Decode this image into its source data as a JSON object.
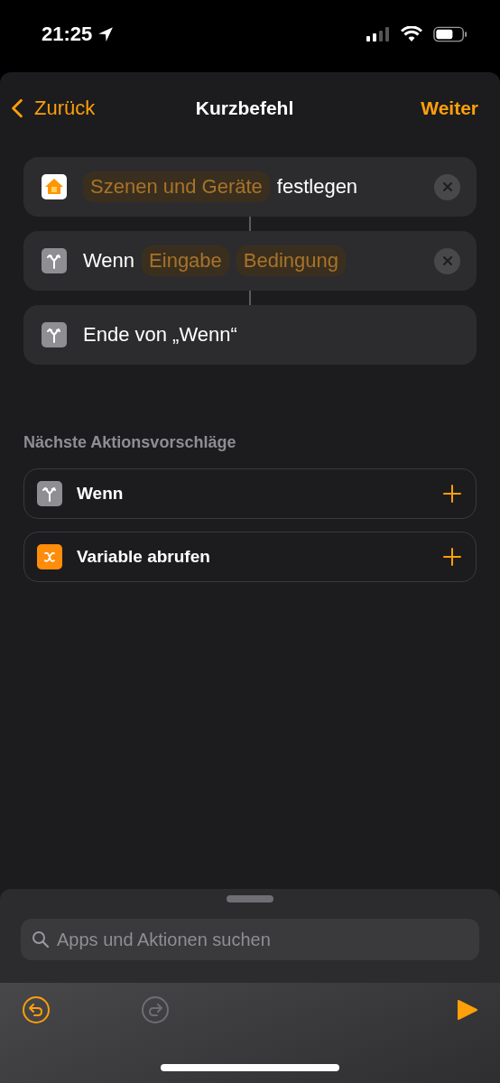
{
  "status_bar": {
    "time": "21:25"
  },
  "nav": {
    "back": "Zurück",
    "title": "Kurzbefehl",
    "next": "Weiter"
  },
  "actions": [
    {
      "kind": "home",
      "removable": true,
      "parts": [
        {
          "kind": "token",
          "text": "Szenen und Geräte"
        },
        {
          "kind": "text",
          "text": "festlegen"
        }
      ]
    },
    {
      "kind": "branch",
      "removable": true,
      "parts": [
        {
          "kind": "text",
          "text": "Wenn"
        },
        {
          "kind": "token",
          "text": "Eingabe"
        },
        {
          "kind": "token",
          "text": "Bedingung"
        }
      ]
    },
    {
      "kind": "branch",
      "removable": false,
      "parts": [
        {
          "kind": "text",
          "text": "Ende von „Wenn“"
        }
      ]
    }
  ],
  "suggestions": {
    "title": "Nächste Aktionsvorschläge",
    "items": [
      {
        "kind": "branch",
        "label": "Wenn"
      },
      {
        "kind": "variable",
        "label": "Variable abrufen"
      }
    ]
  },
  "search": {
    "placeholder": "Apps und Aktionen suchen"
  },
  "toolbar": {
    "undo": {
      "disabled": false
    },
    "redo": {
      "disabled": true
    }
  }
}
